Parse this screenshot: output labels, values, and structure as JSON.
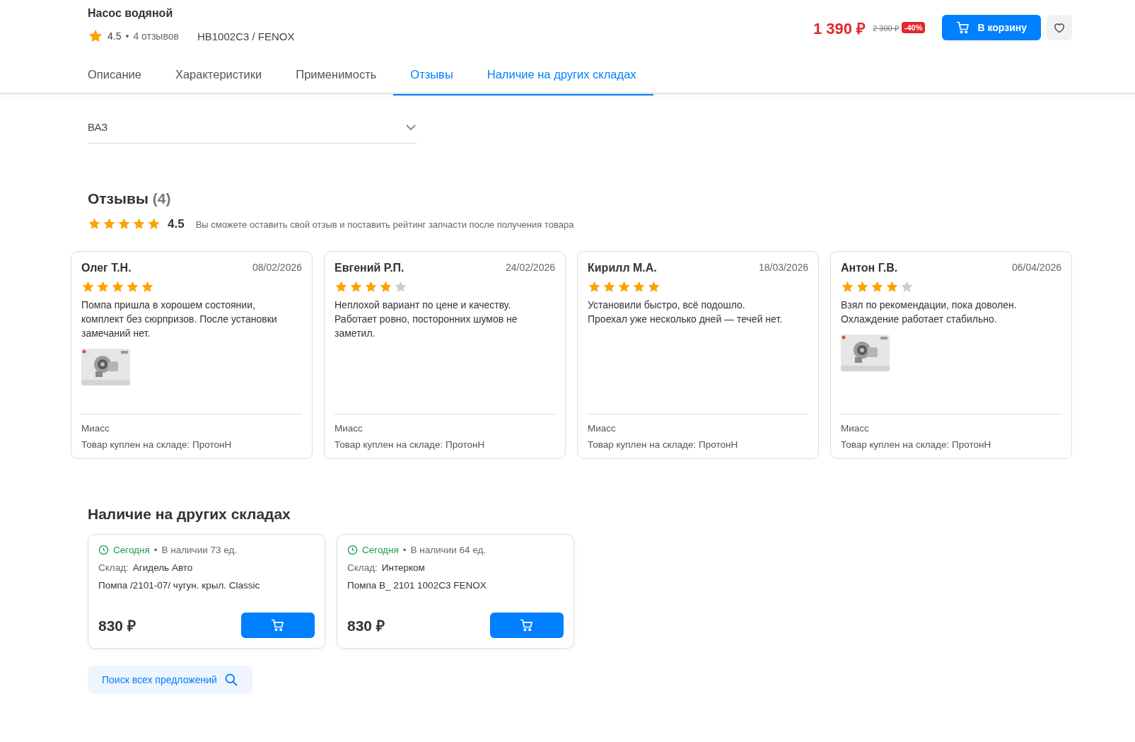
{
  "product": {
    "title": "Насос водяной",
    "rating": "4.5",
    "separator": "•",
    "reviews_count": "4 отзывов",
    "article": "HB1002C3 / FENOX",
    "price": "1 390 ₽",
    "old_price": "2 300 ₽",
    "discount": "-40%",
    "cart_button": "В корзину"
  },
  "tabs": [
    {
      "label": "Описание",
      "selected": false
    },
    {
      "label": "Характеристики",
      "selected": false
    },
    {
      "label": "Применимость",
      "selected": false
    },
    {
      "label": "Отзывы",
      "selected": true
    },
    {
      "label": "Наличие на других складах",
      "selected": true
    }
  ],
  "applicability": {
    "dropdown": {
      "value": "ВАЗ"
    }
  },
  "reviews": {
    "title": "Отзывы",
    "count": "(4)",
    "stars": 5,
    "rating": "4.5",
    "note": "Вы сможете оставить свой отзыв и поставить рейтинг запчасти после получения товара",
    "items": [
      {
        "author": "Олег Т.Н.",
        "date": "08/02/2026",
        "stars": 5,
        "text": "Помпа пришла в хорошем состоянии, комплект без сюрпризов. После установки замечаний нет.",
        "city": "Миасс",
        "purchase": "Товар куплен на складе: ПротонН"
      },
      {
        "author": "Евгений Р.П.",
        "date": "24/02/2026",
        "stars": 4,
        "text": "Неплохой вариант по цене и качеству. Работает ровно, посторонних шумов не заметил.",
        "city": "Миасс",
        "purchase": "Товар куплен на складе: ПротонН"
      },
      {
        "author": "Кирилл М.А.",
        "date": "18/03/2026",
        "stars": 5,
        "text": "Установили быстро, всё подошло. Проехал уже несколько дней — течей нет.",
        "city": "Миасс",
        "purchase": "Товар куплен на складе: ПротонН"
      },
      {
        "author": "Антон Г.В.",
        "date": "06/04/2026",
        "stars": 4,
        "text": "Взял по рекомендации, пока доволен. Охлаждение работает стабильно.",
        "city": "Миасс",
        "purchase": "Товар куплен на складе: ПротонН"
      }
    ]
  },
  "stock": {
    "title": "Наличие на других складах",
    "offers": [
      {
        "delivery": "Сегодня",
        "separator": "•",
        "availability": "В наличии 73 ед.",
        "warehouse_label": "Склад:",
        "warehouse": "Агидель Авто",
        "name": "Помпа /2101-07/ чугун. крыл. Classic",
        "price": "830 ₽"
      },
      {
        "delivery": "Сегодня",
        "separator": "•",
        "availability": "В наличии 64 ед.",
        "warehouse_label": "Склад:",
        "warehouse": "Интерком",
        "name": "Помпа В_ 2101 1002С3 FENOX",
        "price": "830 ₽"
      }
    ],
    "search_button": "Поиск всех предложений"
  }
}
